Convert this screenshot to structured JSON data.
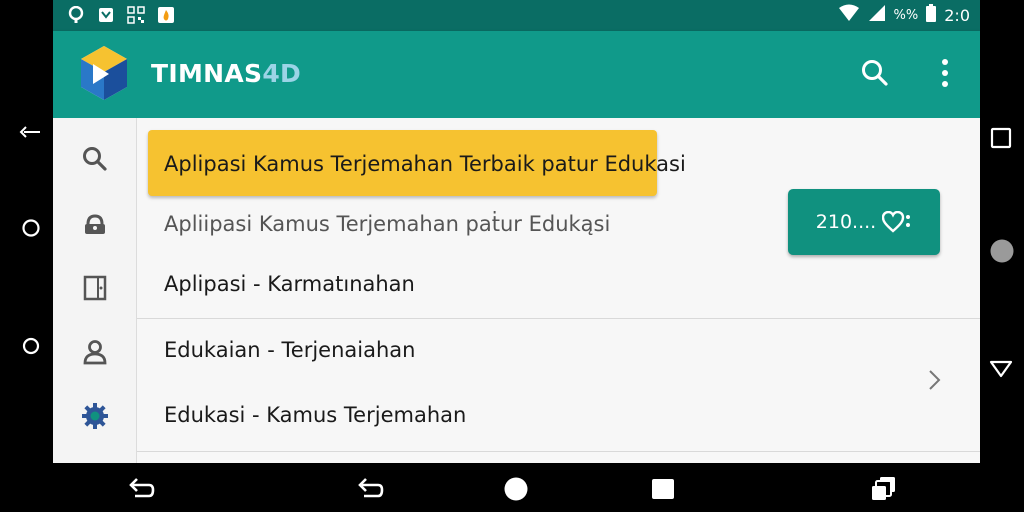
{
  "status_bar": {
    "time": "2:0",
    "battery_text": "%%",
    "left_icons": [
      "location-pin-icon",
      "pocket-icon",
      "qr-icon",
      "fire-icon"
    ],
    "right_icons": [
      "wifi-icon",
      "signal-icon",
      "battery-icon"
    ]
  },
  "app_bar": {
    "title_main": "TIMNAS",
    "title_accent": "4D",
    "actions": [
      "search-icon",
      "more-vert-icon"
    ]
  },
  "rail": {
    "items": [
      "search-icon",
      "lock-icon",
      "door-icon",
      "person-icon",
      "gear-icon"
    ]
  },
  "list": {
    "rows": [
      "Aplipasi Kamus Terjemahan Terbaik patur Edukasi",
      "Apliipasi Kamus Terjemahan paṫur Edukąsi",
      "Aplipasi - Karmatınahan",
      "Edukaian - Terjenaiahan",
      "Edukasi - Kamus Terjemahan"
    ],
    "badge_text": "210....",
    "highlighted_index": 0
  },
  "colors": {
    "status_bar": "#0a6d64",
    "app_bar": "#109a8a",
    "highlight": "#f6c230",
    "badge": "#10917f"
  }
}
